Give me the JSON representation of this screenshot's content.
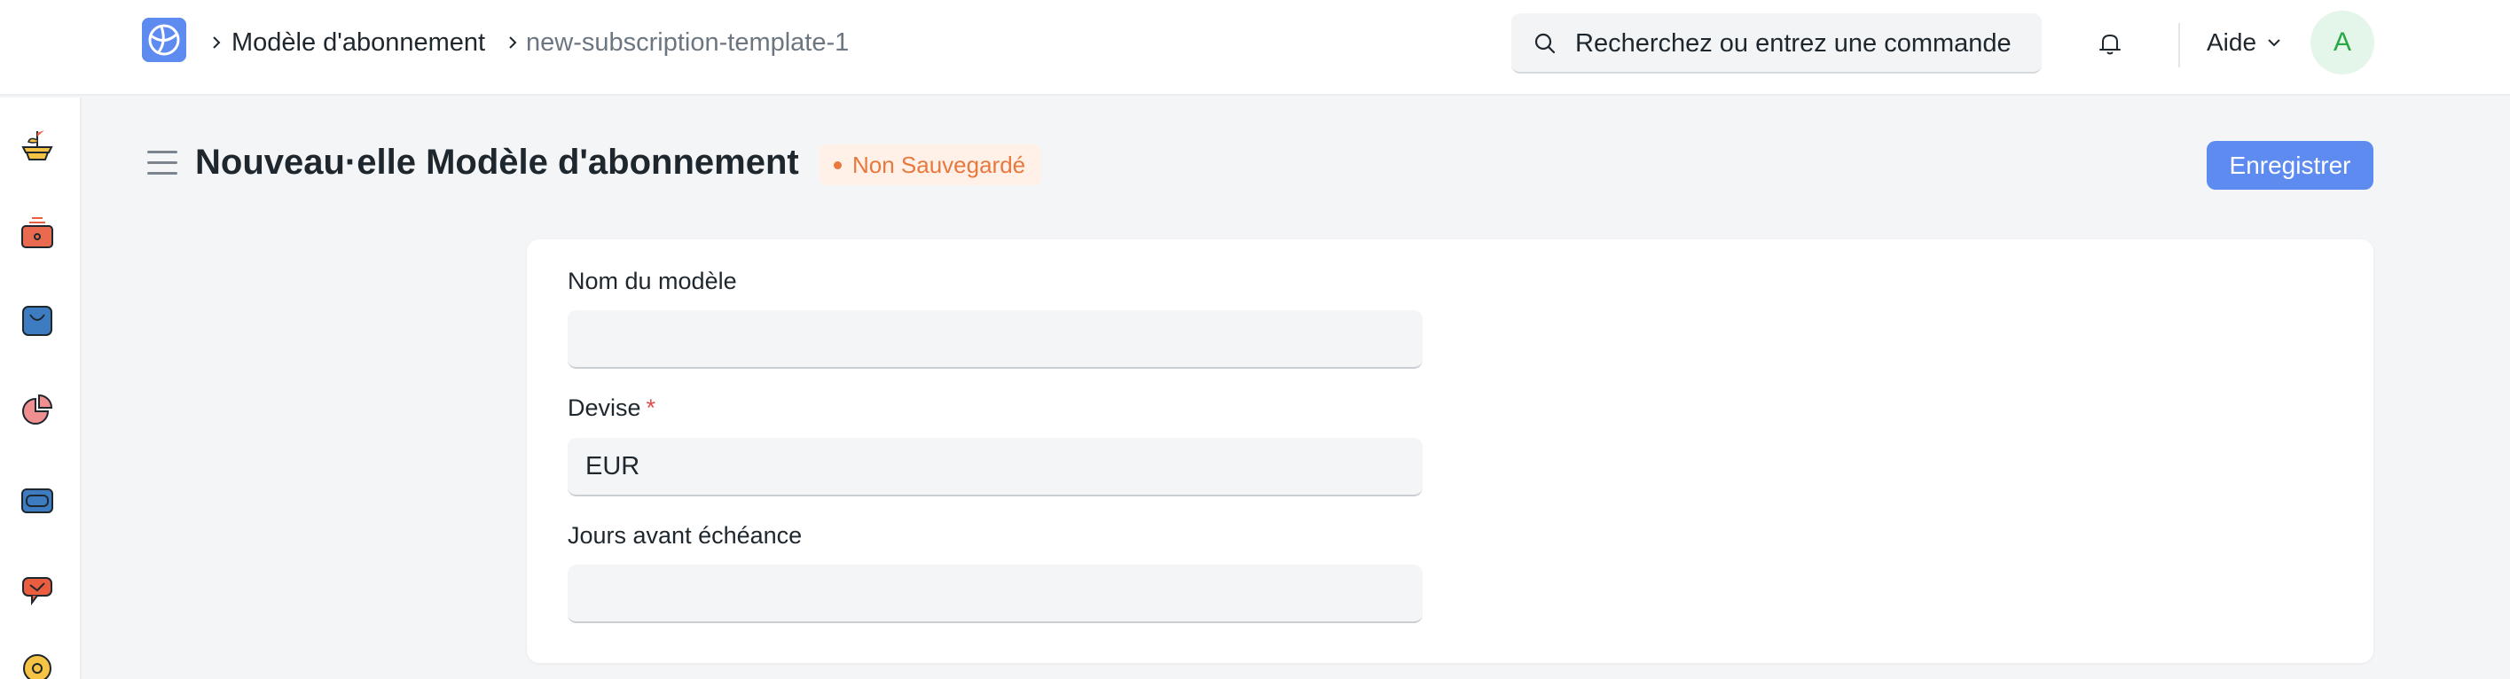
{
  "breadcrumb": {
    "parent": "Modèle d'abonnement",
    "current": "new-subscription-template-1"
  },
  "search": {
    "placeholder": "Recherchez ou entrez une commande"
  },
  "header_right": {
    "help_label": "Aide",
    "avatar_initial": "A"
  },
  "page": {
    "title": "Nouveau·elle Modèle d'abonnement",
    "status": "Non Sauvegardé",
    "save_label": "Enregistrer"
  },
  "form": {
    "template_name": {
      "label": "Nom du modèle",
      "value": ""
    },
    "currency": {
      "label": "Devise",
      "required_mark": "*",
      "value": "EUR"
    },
    "days_until_due": {
      "label": "Jours avant échéance",
      "value": ""
    }
  },
  "sidebar": {
    "icons": [
      "plant-pot-icon",
      "cash-register-icon",
      "shopping-bag-icon",
      "pie-chart-icon",
      "wallet-icon",
      "support-icon",
      "settings-icon"
    ]
  },
  "colors": {
    "accent": "#5e8bef",
    "status": "#e8793e",
    "avatar_bg": "#e4f5e9",
    "avatar_text": "#28a745"
  }
}
